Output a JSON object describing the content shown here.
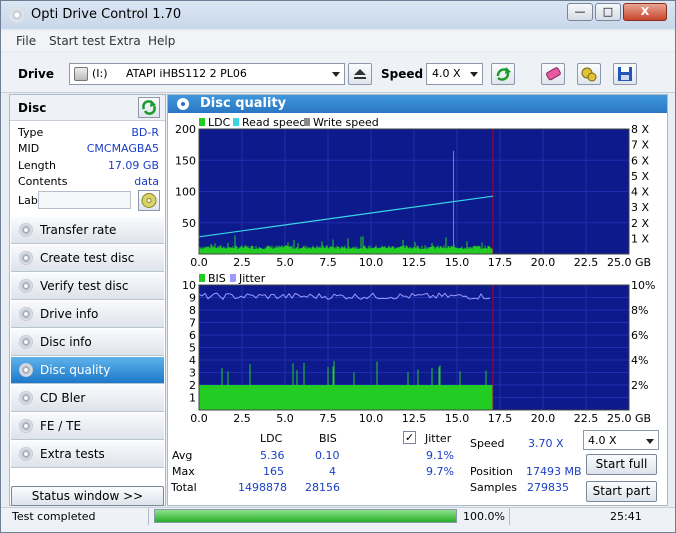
{
  "window": {
    "title": "Opti Drive Control 1.70",
    "min": "—",
    "max": "□",
    "close": "X"
  },
  "menu": [
    "File",
    "Start test",
    "Extra",
    "Help"
  ],
  "toolbar": {
    "drive_label": "Drive",
    "drive_letter": "(I:)",
    "drive_name": "ATAPI  iHBS112   2 PL06",
    "speed_label": "Speed",
    "speed_value": "4.0 X"
  },
  "disc": {
    "header": "Disc",
    "rows": [
      {
        "label": "Type",
        "value": "BD-R"
      },
      {
        "label": "MID",
        "value": "CMCMAGBA5"
      },
      {
        "label": "Length",
        "value": "17.09 GB"
      },
      {
        "label": "Contents",
        "value": "data"
      }
    ],
    "label_label": "Label"
  },
  "nav": [
    {
      "label": "Transfer rate",
      "active": false
    },
    {
      "label": "Create test disc",
      "active": false
    },
    {
      "label": "Verify test disc",
      "active": false
    },
    {
      "label": "Drive info",
      "active": false
    },
    {
      "label": "Disc info",
      "active": false
    },
    {
      "label": "Disc quality",
      "active": true
    },
    {
      "label": "CD Bler",
      "active": false
    },
    {
      "label": "FE / TE",
      "active": false
    },
    {
      "label": "Extra tests",
      "active": false
    }
  ],
  "status_window_label": "Status window >>",
  "panel_title": "Disc quality",
  "chart_data": [
    {
      "type": "bar",
      "legend": [
        "LDC",
        "Read speed",
        "Write speed"
      ],
      "legend_position": "top-left",
      "x_ticks": [
        "0.0",
        "2.5",
        "5.0",
        "7.5",
        "10.0",
        "12.5",
        "15.0",
        "17.5",
        "20.0",
        "22.5",
        "25.0 GB"
      ],
      "xlim": [
        0,
        25
      ],
      "y_left_ticks": [
        "200",
        "150",
        "100",
        "50"
      ],
      "ylim_left": [
        0,
        200
      ],
      "y_right_ticks": [
        "8 X",
        "7 X",
        "6 X",
        "5 X",
        "4 X",
        "3 X",
        "2 X",
        "1 X"
      ],
      "ylim_right": [
        0,
        8
      ],
      "disc_end_gb": 17.09,
      "ldc_baseline": 8,
      "ldc_spike": {
        "x": 14.8,
        "y": 165
      },
      "read_speed": {
        "x": [
          0,
          17.09
        ],
        "y": [
          1.1,
          3.7
        ]
      },
      "grid": true
    },
    {
      "type": "bar",
      "legend": [
        "BIS",
        "Jitter"
      ],
      "legend_position": "top-left",
      "x_ticks": [
        "0.0",
        "2.5",
        "5.0",
        "7.5",
        "10.0",
        "12.5",
        "15.0",
        "17.5",
        "20.0",
        "22.5",
        "25.0 GB"
      ],
      "xlim": [
        0,
        25
      ],
      "y_left_ticks": [
        "10",
        "9",
        "8",
        "7",
        "6",
        "5",
        "4",
        "3",
        "2",
        "1"
      ],
      "ylim_left": [
        0,
        10
      ],
      "y_right_ticks": [
        "10%",
        "8%",
        "6%",
        "4%",
        "2%"
      ],
      "ylim_right": [
        0,
        10
      ],
      "disc_end_gb": 17.09,
      "bis_level": 2,
      "jitter_level_pct": 9.1,
      "grid": true
    }
  ],
  "stats": {
    "col_ldc": "LDC",
    "col_bis": "BIS",
    "jitter_label": "Jitter",
    "jitter_checked": true,
    "rows": [
      {
        "label": "Avg",
        "ldc": "5.36",
        "bis": "0.10",
        "jitter": "9.1%"
      },
      {
        "label": "Max",
        "ldc": "165",
        "bis": "4",
        "jitter": "9.7%"
      },
      {
        "label": "Total",
        "ldc": "1498878",
        "bis": "28156",
        "jitter": ""
      }
    ],
    "speed_label": "Speed",
    "speed_value": "3.70 X",
    "speed_select": "4.0 X",
    "position_label": "Position",
    "position_value": "17493 MB",
    "samples_label": "Samples",
    "samples_value": "279835",
    "start_full": "Start full",
    "start_part": "Start part"
  },
  "status": {
    "text": "Test completed",
    "progress": 100,
    "progress_text": "100.0%",
    "time": "25:41"
  },
  "colors": {
    "ldc": "#22cc22",
    "read_speed": "#3ad6e6",
    "bg": "#0d1a8c",
    "grid": "#1e2eb0",
    "border": "#a00030"
  }
}
